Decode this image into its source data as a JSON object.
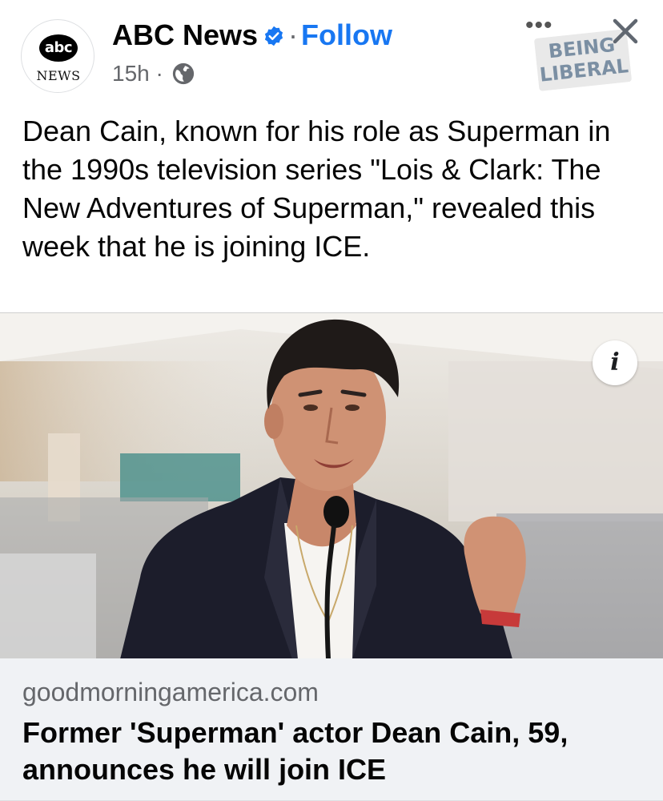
{
  "header": {
    "avatar_logo_text": "abc",
    "avatar_sub_text": "NEWS",
    "page_name": "ABC News",
    "separator": "·",
    "follow_label": "Follow",
    "timestamp": "15h",
    "meta_separator": "·",
    "privacy_icon": "globe-icon",
    "more_icon": "more-dots-icon",
    "more_label": "•••",
    "close_icon": "close-icon",
    "verified_icon": "verified-badge-icon",
    "watermark_line1": "BEING",
    "watermark_line2": "LIBERAL"
  },
  "post": {
    "message": "Dean Cain, known for his role as Superman in the 1990s television series \"Lois & Clark: The New Adventures of Superman,\" revealed this week that he is joining ICE."
  },
  "link_preview": {
    "image_subject": "photo-man-speaking-at-microphone",
    "info_label": "i",
    "domain": "goodmorningamerica.com",
    "title": "Former 'Superman' actor Dean Cain, 59, announces he will join ICE"
  },
  "colors": {
    "accent": "#1877f2",
    "secondary_text": "#65676b",
    "footer_bg": "#f0f2f5"
  }
}
